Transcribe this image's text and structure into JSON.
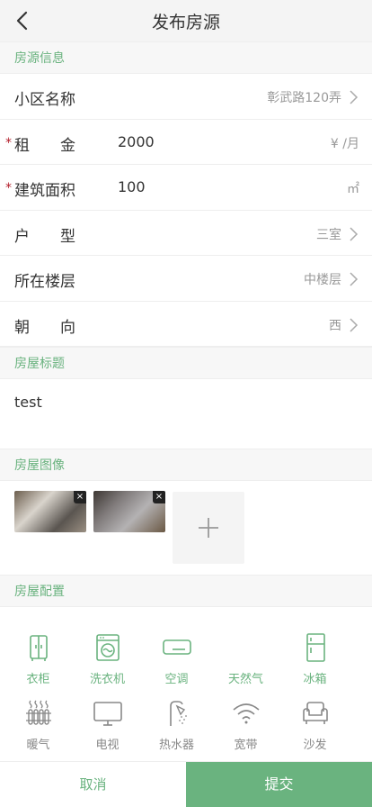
{
  "header": {
    "title": "发布房源"
  },
  "sections": {
    "info": "房源信息",
    "title": "房屋标题",
    "images": "房屋图像",
    "config": "房屋配置"
  },
  "form": {
    "community": {
      "label": "小区名称",
      "value": "彰武路120弄"
    },
    "rent": {
      "required": "*",
      "label": "租　　金",
      "value": "2000",
      "unit": "¥ /月"
    },
    "area": {
      "required": "*",
      "label": "建筑面积",
      "value": "100",
      "unit": "㎡"
    },
    "layout": {
      "label": "户　　型",
      "value": "三室"
    },
    "floor": {
      "label": "所在楼层",
      "value": "中楼层"
    },
    "orientation": {
      "label": "朝　　向",
      "value": "西"
    }
  },
  "house_title": "test",
  "images": {
    "remove_glyph": "×"
  },
  "facilities": [
    {
      "label": "衣柜",
      "icon": "wardrobe-icon",
      "selected": true
    },
    {
      "label": "洗衣机",
      "icon": "washing-machine-icon",
      "selected": true
    },
    {
      "label": "空调",
      "icon": "air-conditioner-icon",
      "selected": true
    },
    {
      "label": "天然气",
      "icon": "gas-flame-icon",
      "selected": true
    },
    {
      "label": "冰箱",
      "icon": "fridge-icon",
      "selected": true
    },
    {
      "label": "暖气",
      "icon": "radiator-icon",
      "selected": false
    },
    {
      "label": "电视",
      "icon": "tv-icon",
      "selected": false
    },
    {
      "label": "热水器",
      "icon": "water-heater-icon",
      "selected": false
    },
    {
      "label": "宽带",
      "icon": "wifi-icon",
      "selected": false
    },
    {
      "label": "沙发",
      "icon": "sofa-icon",
      "selected": false
    }
  ],
  "footer": {
    "cancel": "取消",
    "submit": "提交"
  },
  "colors": {
    "accent": "#6ab37f",
    "required": "#b31d2a"
  }
}
